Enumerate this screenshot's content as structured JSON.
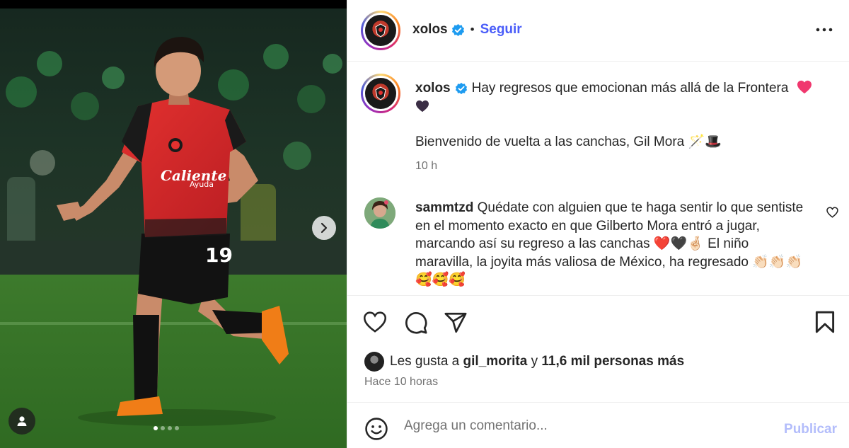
{
  "post": {
    "author": {
      "username": "xolos",
      "verified": true,
      "follow_label": "Seguir",
      "separator": "•"
    },
    "media": {
      "jersey_sponsor": "Caliente",
      "jersey_sponsor_sub": "Ayuda",
      "jersey_number": "19",
      "carousel_count": 4,
      "carousel_active_index": 0
    },
    "caption": {
      "username": "xolos",
      "line1": "Hay regresos que emocionan más allá de la Frontera",
      "line2": "Bienvenido de vuelta a las canchas, Gil Mora 🪄🎩",
      "time": "10 h"
    },
    "comments": [
      {
        "username": "sammtzd",
        "text": "Quédate con alguien que te haga sentir lo que sentiste en el momento exacto en que Gilberto Mora entró a jugar, marcando así su regreso a las canchas ❤️🖤🤞🏻 El niño maravilla, la joyita más valiosa de México, ha regresado 👏🏻👏🏻👏🏻🥰🥰🥰"
      }
    ],
    "likes": {
      "prefix": "Les gusta a",
      "user": "gil_morita",
      "connector": "y",
      "others": "11,6 mil personas más"
    },
    "timestamp": "Hace 10 horas",
    "comment_box": {
      "placeholder": "Agrega un comentario...",
      "publish_label": "Publicar"
    }
  },
  "icons": {
    "verified": "verified-badge-icon",
    "more": "more-options-icon",
    "like": "heart-icon",
    "comment": "comment-icon",
    "share": "paper-plane-icon",
    "save": "bookmark-icon",
    "emoji": "emoji-icon",
    "next": "chevron-right-icon",
    "tag": "person-tag-icon"
  },
  "colors": {
    "link_blue": "#4a5df9",
    "verified_blue": "#1d9bf0",
    "muted": "#737373",
    "publish_disabled": "#b3bdfb",
    "jersey_red": "#d7262c",
    "jersey_black": "#1a1a1a"
  }
}
